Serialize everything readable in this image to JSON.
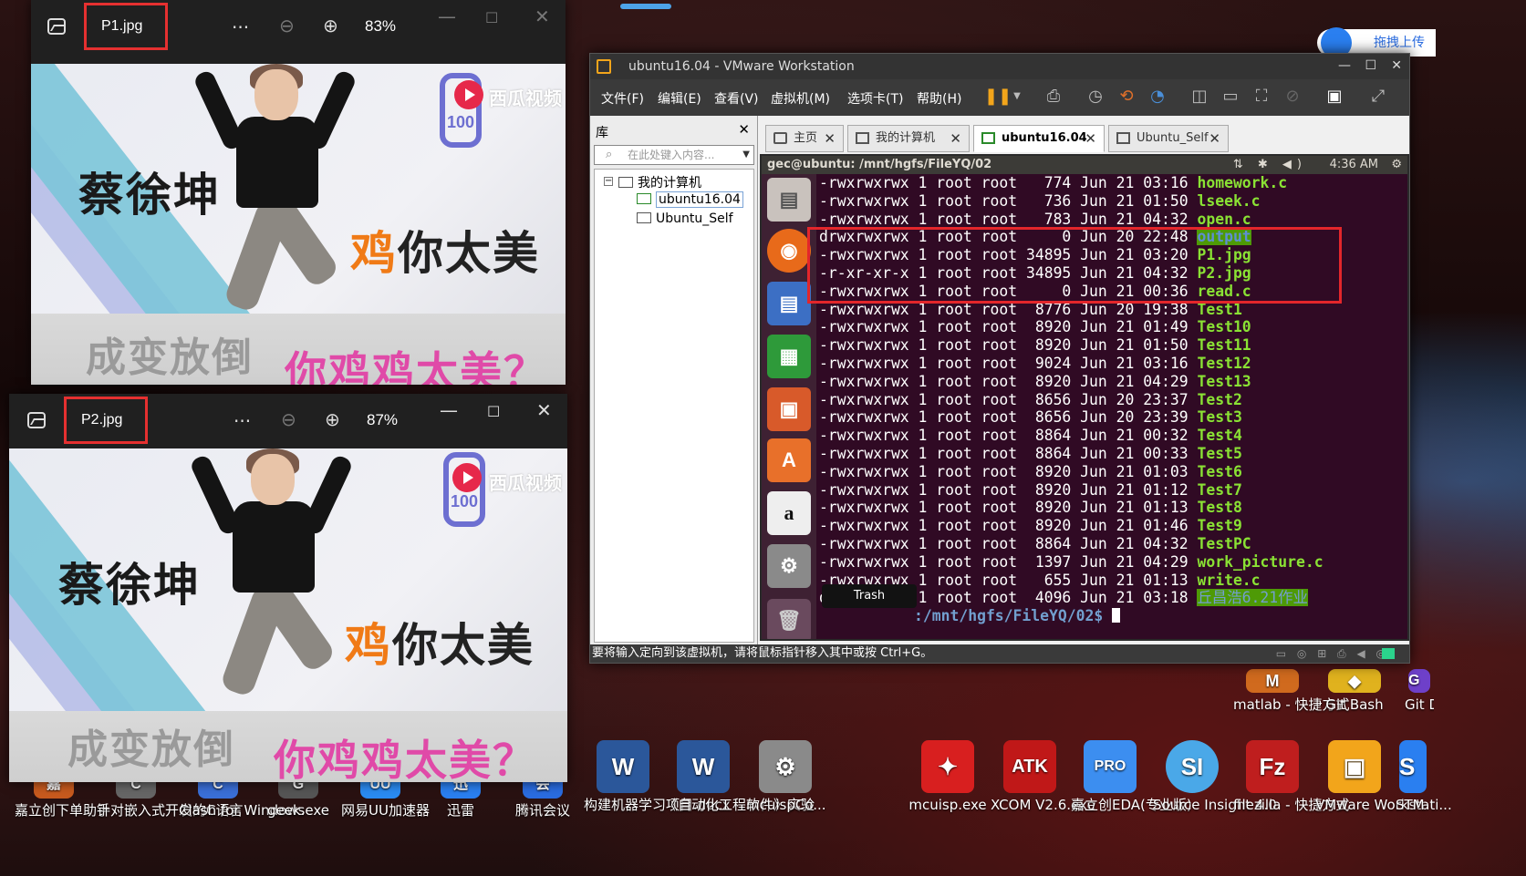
{
  "photo1": {
    "filename": "P1.jpg",
    "zoom": "83%",
    "more": "···",
    "watermark": "西瓜视频",
    "logo_num": "100",
    "caption_black": "蔡徐坤",
    "caption_orange_first": "鸡",
    "caption_orange_rest": "你太美",
    "caption_bottom_grey": "成变放倒",
    "caption_bottom_pink": "你鸡鸡太美？"
  },
  "photo2": {
    "filename": "P2.jpg",
    "zoom": "87%",
    "more": "···",
    "watermark": "西瓜视频",
    "logo_num": "100",
    "caption_black": "蔡徐坤",
    "caption_orange_first": "鸡",
    "caption_orange_rest": "你太美",
    "caption_bottom_grey": "成变放倒",
    "caption_bottom_pink": "你鸡鸡太美？"
  },
  "vmware": {
    "title": "ubuntu16.04 - VMware Workstation",
    "menu": [
      "文件(F)",
      "编辑(E)",
      "查看(V)",
      "虚拟机(M)",
      "选项卡(T)",
      "帮助(H)"
    ],
    "library": {
      "heading": "库",
      "search_placeholder": "在此处键入内容...",
      "root": "我的计算机",
      "items": [
        "ubuntu16.04",
        "Ubuntu_Self"
      ]
    },
    "tabs": [
      "主页",
      "我的计算机",
      "ubuntu16.04",
      "Ubuntu_Self"
    ],
    "status": "要将输入定向到该虚拟机，请将鼠标指针移入其中或按 Ctrl+G。"
  },
  "ubuntu": {
    "window_title": "gec@ubuntu: /mnt/hgfs/FileYQ/02",
    "clock": "4:36 AM",
    "trash_tooltip": "Trash",
    "terminal_lines": [
      {
        "perm": "-rwxrwxrwx 1 root root   774 Jun 21 03:16 ",
        "name": "homework.c",
        "style": "green"
      },
      {
        "perm": "-rwxrwxrwx 1 root root   736 Jun 21 01:50 ",
        "name": "lseek.c",
        "style": "green"
      },
      {
        "perm": "-rwxrwxrwx 1 root root   783 Jun 21 04:32 ",
        "name": "open.c",
        "style": "green"
      },
      {
        "perm": "drwxrwxrwx 1 root root     0 Jun 20 22:48 ",
        "name": "output",
        "style": "hl"
      },
      {
        "perm": "-rwxrwxrwx 1 root root 34895 Jun 21 03:20 ",
        "name": "P1.jpg",
        "style": "green"
      },
      {
        "perm": "-r-xr-xr-x 1 root root 34895 Jun 21 04:32 ",
        "name": "P2.jpg",
        "style": "green"
      },
      {
        "perm": "-rwxrwxrwx 1 root root     0 Jun 21 00:36 ",
        "name": "read.c",
        "style": "green"
      },
      {
        "perm": "-rwxrwxrwx 1 root root  8776 Jun 20 19:38 ",
        "name": "Test1",
        "style": "green"
      },
      {
        "perm": "-rwxrwxrwx 1 root root  8920 Jun 21 01:49 ",
        "name": "Test10",
        "style": "green"
      },
      {
        "perm": "-rwxrwxrwx 1 root root  8920 Jun 21 01:50 ",
        "name": "Test11",
        "style": "green"
      },
      {
        "perm": "-rwxrwxrwx 1 root root  9024 Jun 21 03:16 ",
        "name": "Test12",
        "style": "green"
      },
      {
        "perm": "-rwxrwxrwx 1 root root  8920 Jun 21 04:29 ",
        "name": "Test13",
        "style": "green"
      },
      {
        "perm": "-rwxrwxrwx 1 root root  8656 Jun 20 23:37 ",
        "name": "Test2",
        "style": "green"
      },
      {
        "perm": "-rwxrwxrwx 1 root root  8656 Jun 20 23:39 ",
        "name": "Test3",
        "style": "green"
      },
      {
        "perm": "-rwxrwxrwx 1 root root  8864 Jun 21 00:32 ",
        "name": "Test4",
        "style": "green"
      },
      {
        "perm": "-rwxrwxrwx 1 root root  8864 Jun 21 00:33 ",
        "name": "Test5",
        "style": "green"
      },
      {
        "perm": "-rwxrwxrwx 1 root root  8920 Jun 21 01:03 ",
        "name": "Test6",
        "style": "green"
      },
      {
        "perm": "-rwxrwxrwx 1 root root  8920 Jun 21 01:12 ",
        "name": "Test7",
        "style": "green"
      },
      {
        "perm": "-rwxrwxrwx 1 root root  8920 Jun 21 01:13 ",
        "name": "Test8",
        "style": "green"
      },
      {
        "perm": "-rwxrwxrwx 1 root root  8920 Jun 21 01:46 ",
        "name": "Test9",
        "style": "green"
      },
      {
        "perm": "-rwxrwxrwx 1 root root  8864 Jun 21 04:32 ",
        "name": "TestPC",
        "style": "green"
      },
      {
        "perm": "-rwxrwxrwx 1 root root  1397 Jun 21 04:29 ",
        "name": "work_picture.c",
        "style": "green"
      },
      {
        "perm": "-rwxrwxrwx 1 root root   655 Jun 21 01:13 ",
        "name": "write.c",
        "style": "green"
      },
      {
        "perm": "drwxrwxrwx 1 root root  4096 Jun 21 03:18 ",
        "name": "丘昌浩6.21作业",
        "style": "hl2"
      }
    ],
    "prompt_path": ":/mnt/hgfs/FileYQ/02$ "
  },
  "desktop": {
    "upload_badge": "拖拽上传",
    "icons": [
      {
        "label": "嘉立创下单助手",
        "glyph": "嘉",
        "color": "#c75a1e"
      },
      {
        "label": "针对嵌入式开发的C语言",
        "glyph": "C",
        "color": "#666666"
      },
      {
        "label": "Clash for Windows",
        "glyph": "C",
        "color": "#3a6fd8"
      },
      {
        "label": "geek.exe",
        "glyph": "G",
        "color": "#555555"
      },
      {
        "label": "网易UU加速器",
        "glyph": "UU",
        "color": "#2a8bf2"
      },
      {
        "label": "迅雷",
        "glyph": "迅",
        "color": "#2a7ff0"
      },
      {
        "label": "腾讯会议",
        "glyph": "会",
        "color": "#2a6ce0"
      },
      {
        "label": "构建机器学习项目.docx",
        "glyph": "W",
        "color": "#2b579a"
      },
      {
        "label": "《自动化工程软件》实验",
        "glyph": "W",
        "color": "#2b579a"
      },
      {
        "label": "mcuispCo...",
        "glyph": "⚙",
        "color": "#8a8a8a"
      },
      {
        "label": "mcuisp.exe",
        "glyph": "✦",
        "color": "#d81f1f"
      },
      {
        "label": "XCOM V2.6.exe",
        "glyph": "ATK",
        "color": "#c01818"
      },
      {
        "label": "嘉立创EDA(专业版)",
        "glyph": "PRO",
        "color": "#3c8ef0"
      },
      {
        "label": "Source Insight 4.0",
        "glyph": "SI",
        "color": "#4aa8e8"
      },
      {
        "label": "filezilla - 快捷方式",
        "glyph": "Fz",
        "color": "#bf1e1e"
      },
      {
        "label": "VMware Workstati...",
        "glyph": "▣",
        "color": "#f2a51b"
      },
      {
        "label": "STM",
        "glyph": "S",
        "color": "#2a7ff0"
      },
      {
        "label": "matlab - 快捷方式",
        "glyph": "M",
        "color": "#d06a1e"
      },
      {
        "label": "Git Bash",
        "glyph": "◆",
        "color": "#e0b21e"
      },
      {
        "label": "Git Des",
        "glyph": "G",
        "color": "#6e40c9"
      }
    ]
  },
  "colors": {
    "red_highlight": "#e3262b",
    "terminal_bg": "#300a24",
    "ls_exec_green": "#8ae234"
  }
}
